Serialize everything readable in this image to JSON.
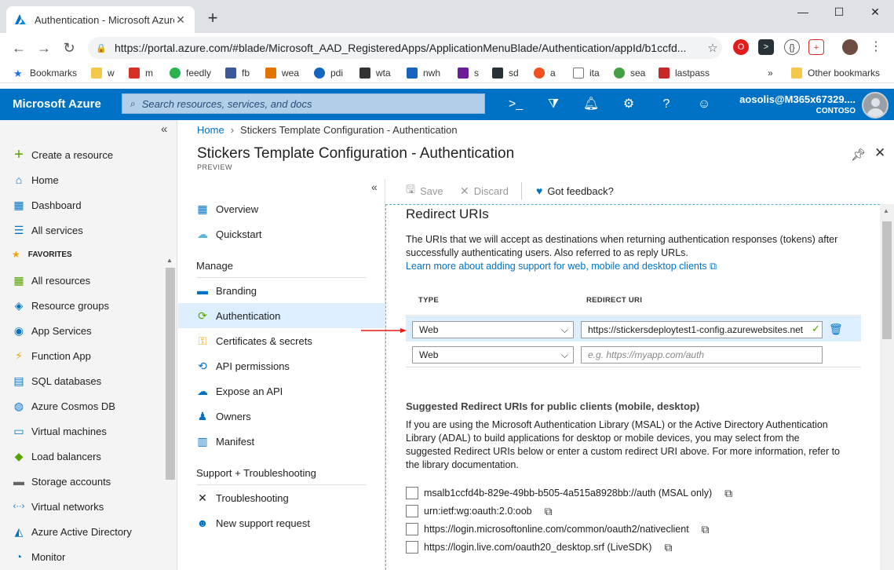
{
  "browser": {
    "tab_title": "Authentication - Microsoft Azure",
    "url": "https://portal.azure.com/#blade/Microsoft_AAD_RegisteredApps/ApplicationMenuBlade/Authentication/appId/b1ccfd...",
    "bookmarks": [
      {
        "label": "Bookmarks",
        "icon": "star-icon",
        "color": "#1a73e8"
      },
      {
        "label": "w",
        "icon": "folder-icon",
        "color": "#f2c94c"
      },
      {
        "label": "m",
        "icon": "gmail-icon",
        "color": "#d93025"
      },
      {
        "label": "feedly",
        "icon": "feedly-icon",
        "color": "#2bb24c"
      },
      {
        "label": "fb",
        "icon": "facebook-icon",
        "color": "#3b5998"
      },
      {
        "label": "wea",
        "icon": "weather-icon",
        "color": "#e37400"
      },
      {
        "label": "pdi",
        "icon": "inq-icon",
        "color": "#1565c0"
      },
      {
        "label": "wta",
        "icon": "wta-icon",
        "color": "#333333"
      },
      {
        "label": "nwh",
        "icon": "nwh-icon",
        "color": "#1565c0"
      },
      {
        "label": "s",
        "icon": "s-icon",
        "color": "#6a1b9a"
      },
      {
        "label": "sd",
        "icon": "sd-icon",
        "color": "#263238"
      },
      {
        "label": "a",
        "icon": "ars-icon",
        "color": "#f4511e"
      },
      {
        "label": "ita",
        "icon": "page-icon",
        "color": "#777777"
      },
      {
        "label": "sea",
        "icon": "sea-icon",
        "color": "#43a047"
      },
      {
        "label": "lastpass",
        "icon": "lastpass-icon",
        "color": "#c62828"
      }
    ],
    "overflow_label": "»",
    "other_bookmarks": "Other bookmarks"
  },
  "azure": {
    "brand": "Microsoft Azure",
    "search_placeholder": "Search resources, services, and docs",
    "user_name": "aosolis@M365x67329....",
    "user_tenant": "CONTOSO",
    "accent": "#0072c6"
  },
  "sidebar": {
    "create": "Create a resource",
    "home": "Home",
    "dashboard": "Dashboard",
    "all_services": "All services",
    "favorites": "FAVORITES",
    "items": [
      {
        "label": "All resources",
        "icon": "grid-icon"
      },
      {
        "label": "Resource groups",
        "icon": "cube-icon"
      },
      {
        "label": "App Services",
        "icon": "globe-icon"
      },
      {
        "label": "Function App",
        "icon": "bolt-icon"
      },
      {
        "label": "SQL databases",
        "icon": "sql-icon"
      },
      {
        "label": "Azure Cosmos DB",
        "icon": "planet-icon"
      },
      {
        "label": "Virtual machines",
        "icon": "monitor-icon"
      },
      {
        "label": "Load balancers",
        "icon": "diamond-icon"
      },
      {
        "label": "Storage accounts",
        "icon": "storage-icon"
      },
      {
        "label": "Virtual networks",
        "icon": "network-icon"
      },
      {
        "label": "Azure Active Directory",
        "icon": "aad-icon"
      },
      {
        "label": "Monitor",
        "icon": "gauge-icon"
      }
    ]
  },
  "blade": {
    "breadcrumb_home": "Home",
    "breadcrumb_current": "Stickers Template Configuration - Authentication",
    "title": "Stickers Template Configuration - Authentication",
    "subtitle": "PREVIEW"
  },
  "resource_menu": {
    "overview": "Overview",
    "quickstart": "Quickstart",
    "manage_header": "Manage",
    "branding": "Branding",
    "authentication": "Authentication",
    "certificates": "Certificates & secrets",
    "api_permissions": "API permissions",
    "expose_api": "Expose an API",
    "owners": "Owners",
    "manifest": "Manifest",
    "support_header": "Support + Troubleshooting",
    "troubleshooting": "Troubleshooting",
    "new_support": "New support request"
  },
  "commands": {
    "save": "Save",
    "discard": "Discard",
    "feedback": "Got feedback?"
  },
  "redirect": {
    "title": "Redirect URIs",
    "desc1": "The URIs that we will accept as destinations when returning authentication responses (tokens) after",
    "desc2": "successfully authenticating users. Also referred to as reply URLs.",
    "learn_more": "Learn more about adding support for web, mobile and desktop clients",
    "col_type": "TYPE",
    "col_uri": "REDIRECT URI",
    "rows": [
      {
        "type": "Web",
        "uri": "https://stickersdeploytest1-config.azurewebsites.net"
      },
      {
        "type": "Web",
        "uri_placeholder": "e.g. https://myapp.com/auth"
      }
    ]
  },
  "suggested": {
    "title": "Suggested Redirect URIs for public clients (mobile, desktop)",
    "lines": [
      "If you are using the Microsoft Authentication Library (MSAL) or the Active Directory Authentication",
      "Library (ADAL) to build applications for desktop or mobile devices, you may select from the",
      "suggested Redirect URIs below or enter a custom redirect URI above. For more information, refer to",
      "the library documentation."
    ],
    "options": [
      "msalb1ccfd4b-829e-49bb-b505-4a515a8928bb://auth (MSAL only)",
      "urn:ietf:wg:oauth:2.0:oob",
      "https://login.microsoftonline.com/common/oauth2/nativeclient",
      "https://login.live.com/oauth20_desktop.srf (LiveSDK)"
    ]
  }
}
